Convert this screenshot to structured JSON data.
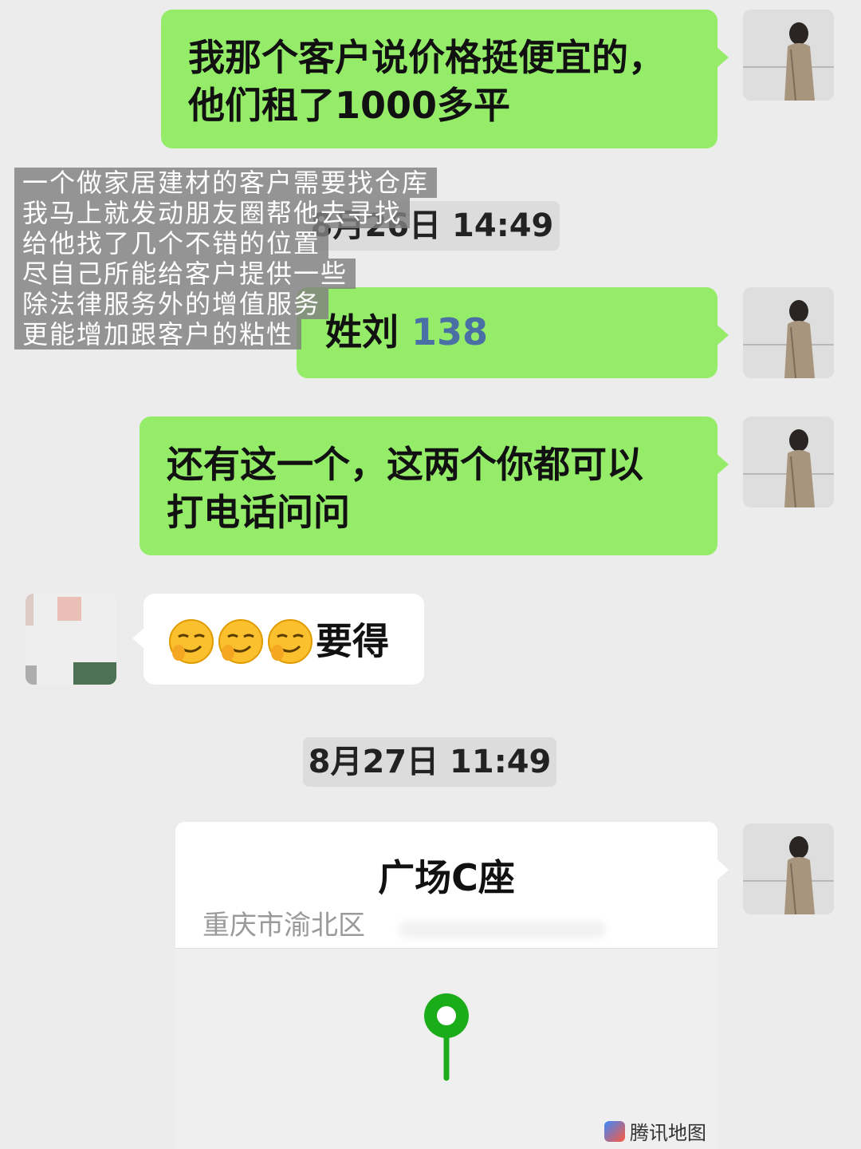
{
  "messages": [
    {
      "text_lines": [
        "我那个客户说价格挺便宜的，",
        "他们租了1000多平"
      ]
    },
    {
      "prefix": "姓刘 ",
      "phone": "138"
    },
    {
      "text_lines": [
        "还有这一个，这两个你都可以",
        "打电话问问"
      ]
    },
    {
      "emoji_name": "smirking-face-emoji",
      "text": "要得"
    }
  ],
  "timestamps": [
    "8月26日 14:49",
    "8月27日 11:49"
  ],
  "overlay_caption": [
    "一个做家居建材的客户需要找仓库",
    "我马上就发动朋友圈帮他去寻找",
    "给他找了几个不错的位置",
    "尽自己所能给客户提供一些",
    "除法律服务外的增值服务",
    "更能增加跟客户的粘性"
  ],
  "location": {
    "title": "广场C座",
    "address": "重庆市渝北区",
    "map_provider": "腾讯地图",
    "pin_color": "#1aad19"
  },
  "colors": {
    "sent_bubble": "#95ec69",
    "received_bubble": "#ffffff",
    "background": "#ececec"
  }
}
